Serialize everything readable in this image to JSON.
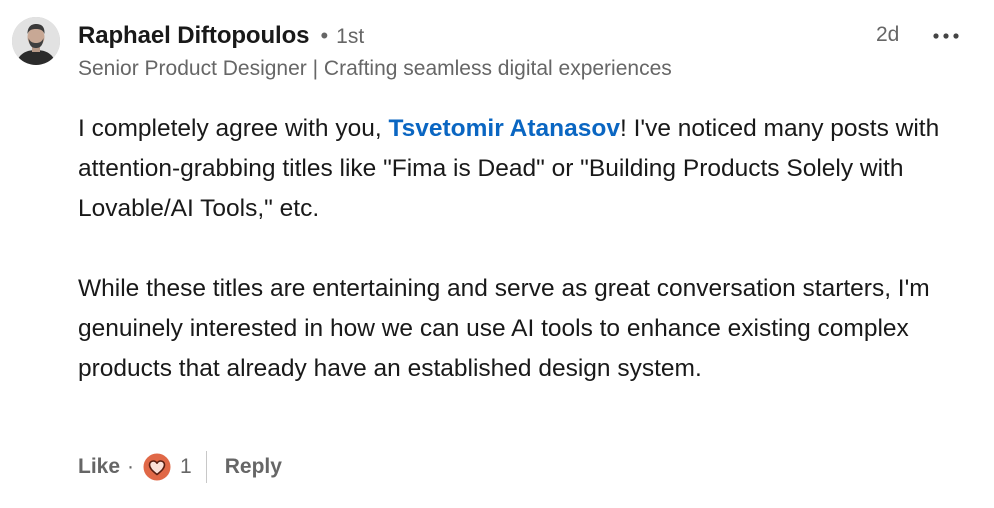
{
  "comment": {
    "author": {
      "name": "Raphael Diftopoulos",
      "separator": "•",
      "degree": "1st",
      "headline": "Senior Product Designer | Crafting seamless digital experiences",
      "avatar_icon": "profile-photo"
    },
    "timestamp": "2d",
    "more_icon": "more-horizontal-icon",
    "body": {
      "p1_before": "I completely agree with you, ",
      "mention": "Tsvetomir Atanasov",
      "p1_after": "! I've noticed many posts with attention-grabbing titles like \"Fima is Dead\" or \"Building Products Solely with Lovable/AI Tools,\" etc.",
      "p2": "While these titles are entertaining and serve as great conversation starters, I'm genuinely interested in how we can use AI tools to enhance existing complex products that already have an established design system."
    },
    "actions": {
      "like_label": "Like",
      "dot": "·",
      "reaction_icon": "heart-reaction-icon",
      "reaction_count": "1",
      "reply_label": "Reply"
    }
  },
  "colors": {
    "text_primary": "#191919",
    "text_secondary": "#666666",
    "mention": "#0a66c2",
    "reaction_orange": "#e06847",
    "divider": "#c8c8c8"
  }
}
